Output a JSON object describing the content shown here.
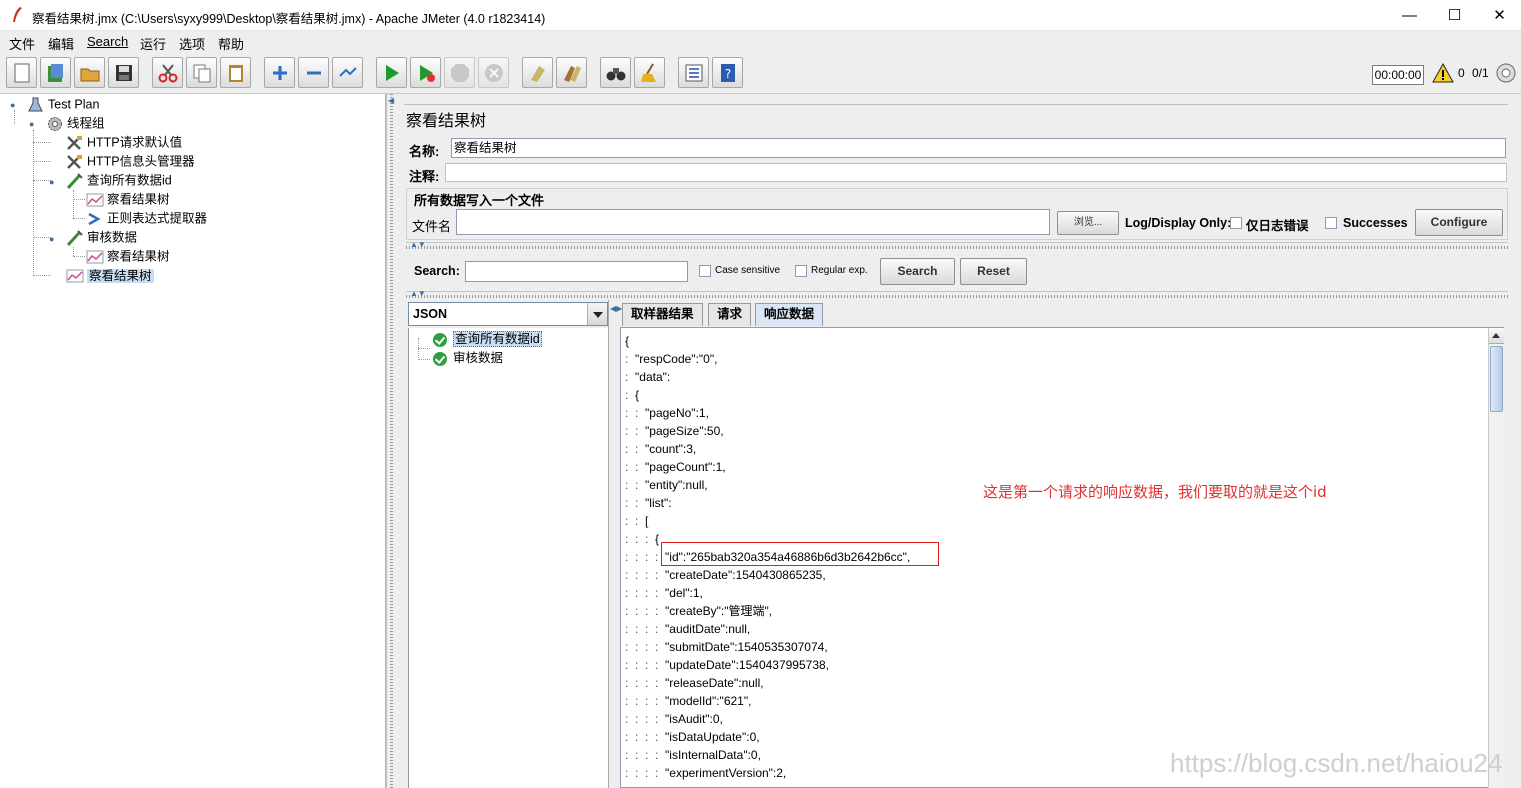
{
  "window": {
    "title": "察看结果树.jmx (C:\\Users\\syxy999\\Desktop\\察看结果树.jmx) - Apache JMeter (4.0 r1823414)",
    "minimize": "—",
    "maximize": "☐",
    "close": "✕"
  },
  "menu": [
    "文件",
    "编辑",
    "Search",
    "运行",
    "选项",
    "帮助"
  ],
  "toolbar": {
    "buttons": [
      "new-icon",
      "templates-icon",
      "open-icon",
      "save-icon",
      "cut-icon",
      "copy-icon",
      "paste-icon",
      "expand-icon",
      "collapse-icon",
      "toggle-icon",
      "start-icon",
      "start-no-pauses-icon",
      "stop-icon",
      "shutdown-icon",
      "clear-icon",
      "clear-all-icon",
      "search-icon",
      "reset-search-icon",
      "function-helper-icon",
      "help-icon"
    ],
    "timer": "00:00:00",
    "warning_count": "0",
    "threads": "0/1"
  },
  "tree": {
    "items": [
      {
        "label": "Test Plan",
        "icon": "test-plan-icon"
      },
      {
        "label": "线程组",
        "icon": "thread-group-icon"
      },
      {
        "label": "HTTP请求默认值",
        "icon": "config-tool-icon"
      },
      {
        "label": "HTTP信息头管理器",
        "icon": "config-tool-icon"
      },
      {
        "label": "查询所有数据id",
        "icon": "sampler-icon"
      },
      {
        "label": "察看结果树",
        "icon": "listener-icon"
      },
      {
        "label": "正则表达式提取器",
        "icon": "extractor-icon"
      },
      {
        "label": "审核数据",
        "icon": "sampler-icon"
      },
      {
        "label": "察看结果树",
        "icon": "listener-icon"
      },
      {
        "label": "察看结果树",
        "icon": "listener-icon"
      }
    ]
  },
  "panel": {
    "title": "察看结果树",
    "name_label": "名称:",
    "name_value": "察看结果树",
    "comment_label": "注释:",
    "comment_value": "",
    "file_group_title": "所有数据写入一个文件",
    "file_label": "文件名",
    "file_value": "",
    "browse_label": "浏览...",
    "log_display_label": "Log/Display Only:",
    "errors_only_label": "仅日志错误",
    "successes_label": "Successes",
    "configure_label": "Configure"
  },
  "search": {
    "label": "Search:",
    "value": "",
    "case_sensitive": "Case sensitive",
    "regular_exp": "Regular exp.",
    "search_button": "Search",
    "reset_button": "Reset"
  },
  "results": {
    "renderer": "JSON",
    "samples": [
      "查询所有数据id",
      "审核数据"
    ],
    "tabs": [
      "取样器结果",
      "请求",
      "响应数据"
    ],
    "active_tab": "响应数据",
    "lines": [
      {
        "indent": "",
        "text": "{"
      },
      {
        "indent": ":  ",
        "text": "\"respCode\":\"0\","
      },
      {
        "indent": ":  ",
        "text": "\"data\":"
      },
      {
        "indent": ":  ",
        "text": "{"
      },
      {
        "indent": ":  :  ",
        "text": "\"pageNo\":1,"
      },
      {
        "indent": ":  :  ",
        "text": "\"pageSize\":50,"
      },
      {
        "indent": ":  :  ",
        "text": "\"count\":3,"
      },
      {
        "indent": ":  :  ",
        "text": "\"pageCount\":1,"
      },
      {
        "indent": ":  :  ",
        "text": "\"entity\":null,"
      },
      {
        "indent": ":  :  ",
        "text": "\"list\":"
      },
      {
        "indent": ":  :  ",
        "text": "["
      },
      {
        "indent": ":  :  :  ",
        "text": "{"
      },
      {
        "indent": ":  :  :  :  ",
        "text": "\"id\":\"265bab320a354a46886b6d3b2642b6cc\","
      },
      {
        "indent": ":  :  :  :  ",
        "text": "\"createDate\":1540430865235,"
      },
      {
        "indent": ":  :  :  :  ",
        "text": "\"del\":1,"
      },
      {
        "indent": ":  :  :  :  ",
        "text": "\"createBy\":\"管理端\","
      },
      {
        "indent": ":  :  :  :  ",
        "text": "\"auditDate\":null,"
      },
      {
        "indent": ":  :  :  :  ",
        "text": "\"submitDate\":1540535307074,"
      },
      {
        "indent": ":  :  :  :  ",
        "text": "\"updateDate\":1540437995738,"
      },
      {
        "indent": ":  :  :  :  ",
        "text": "\"releaseDate\":null,"
      },
      {
        "indent": ":  :  :  :  ",
        "text": "\"modelId\":\"621\","
      },
      {
        "indent": ":  :  :  :  ",
        "text": "\"isAudit\":0,"
      },
      {
        "indent": ":  :  :  :  ",
        "text": "\"isDataUpdate\":0,"
      },
      {
        "indent": ":  :  :  :  ",
        "text": "\"isInternalData\":0,"
      },
      {
        "indent": ":  :  :  :  ",
        "text": "\"experimentVersion\":2,"
      }
    ]
  },
  "annotation": "这是第一个请求的响应数据，我们要取的就是这个id",
  "watermark": "https://blog.csdn.net/haiou24",
  "colors": {
    "annotation": "#e03030",
    "selection": "#c8ddf2",
    "ok": "#2ea043"
  }
}
